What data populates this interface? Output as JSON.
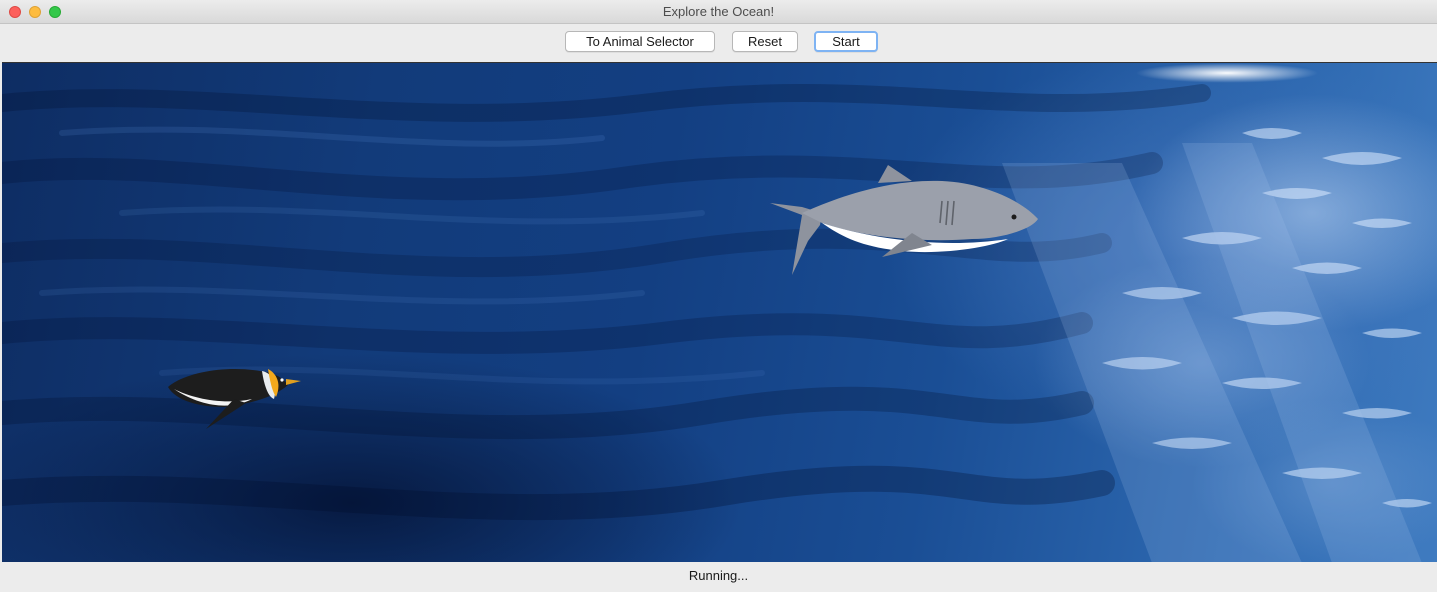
{
  "window": {
    "title": "Explore the Ocean!"
  },
  "toolbar": {
    "animal_selector_label": "To Animal Selector",
    "reset_label": "Reset",
    "start_label": "Start"
  },
  "scene": {
    "background": "ocean-water",
    "animals": [
      {
        "name": "shark",
        "icon": "shark-illustration"
      },
      {
        "name": "penguin",
        "icon": "penguin-illustration"
      }
    ]
  },
  "status": {
    "text": "Running..."
  },
  "colors": {
    "accent": "#7eb3f3",
    "close": "#fc605c",
    "minimize": "#fdbc40",
    "maximize": "#34c84a"
  }
}
